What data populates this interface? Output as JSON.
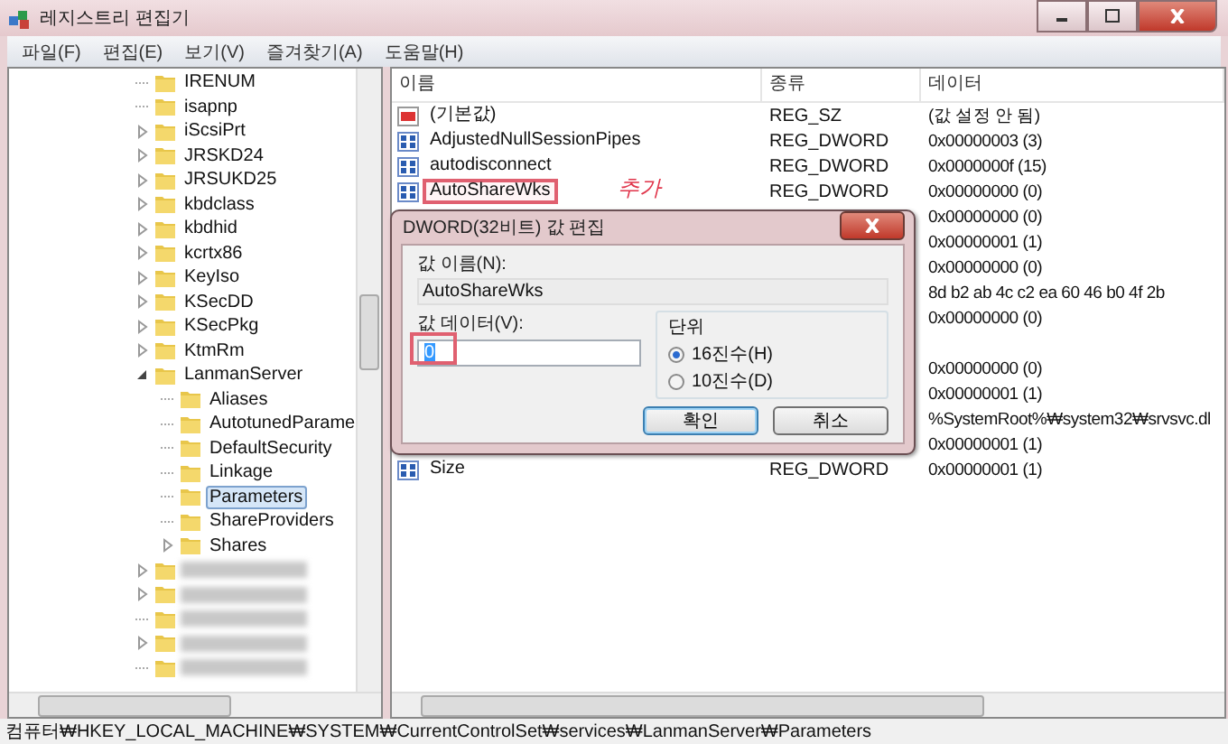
{
  "window": {
    "title": "레지스트리 편집기"
  },
  "menu": [
    "파일(F)",
    "편집(E)",
    "보기(V)",
    "즐겨찾기(A)",
    "도움말(H)"
  ],
  "tree": [
    {
      "label": "IRENUM",
      "has_children": false,
      "selected": false
    },
    {
      "label": "isapnp",
      "has_children": false,
      "selected": false
    },
    {
      "label": "iScsiPrt",
      "has_children": true,
      "expanded": false,
      "selected": false
    },
    {
      "label": "JRSKD24",
      "has_children": true,
      "expanded": false,
      "selected": false
    },
    {
      "label": "JRSUKD25",
      "has_children": true,
      "expanded": false,
      "selected": false
    },
    {
      "label": "kbdclass",
      "has_children": true,
      "expanded": false,
      "selected": false
    },
    {
      "label": "kbdhid",
      "has_children": true,
      "expanded": false,
      "selected": false
    },
    {
      "label": "kcrtx86",
      "has_children": true,
      "expanded": false,
      "selected": false
    },
    {
      "label": "KeyIso",
      "has_children": true,
      "expanded": false,
      "selected": false
    },
    {
      "label": "KSecDD",
      "has_children": true,
      "expanded": false,
      "selected": false
    },
    {
      "label": "KSecPkg",
      "has_children": true,
      "expanded": false,
      "selected": false
    },
    {
      "label": "KtmRm",
      "has_children": true,
      "expanded": false,
      "selected": false
    },
    {
      "label": "LanmanServer",
      "has_children": true,
      "expanded": true,
      "selected": false,
      "children": [
        {
          "label": "Aliases",
          "has_children": false,
          "selected": false
        },
        {
          "label": "AutotunedParame",
          "has_children": false,
          "selected": false
        },
        {
          "label": "DefaultSecurity",
          "has_children": false,
          "selected": false
        },
        {
          "label": "Linkage",
          "has_children": false,
          "selected": false
        },
        {
          "label": "Parameters",
          "has_children": false,
          "selected": true
        },
        {
          "label": "ShareProviders",
          "has_children": false,
          "selected": false
        },
        {
          "label": "Shares",
          "has_children": true,
          "expanded": false,
          "selected": false
        }
      ]
    },
    {
      "kind": "blurred",
      "has_children": true,
      "expanded": false
    },
    {
      "kind": "blurred",
      "has_children": true,
      "expanded": false
    },
    {
      "kind": "blurred",
      "has_children": false
    },
    {
      "kind": "blurred",
      "has_children": true,
      "expanded": false
    },
    {
      "kind": "blurred",
      "has_children": false
    }
  ],
  "list": {
    "columns": [
      "이름",
      "종류",
      "데이터"
    ],
    "rows": [
      {
        "kind": "sz",
        "name": "(기본값)",
        "type": "REG_SZ",
        "data": "(값 설정 안 됨)",
        "highlighted": false
      },
      {
        "kind": "dword",
        "name": "AdjustedNullSessionPipes",
        "type": "REG_DWORD",
        "data": "0x00000003 (3)",
        "highlighted": false
      },
      {
        "kind": "dword",
        "name": "autodisconnect",
        "type": "REG_DWORD",
        "data": "0x0000000f (15)",
        "highlighted": false
      },
      {
        "kind": "dword",
        "name": "AutoShareWks",
        "type": "REG_DWORD",
        "data": "0x00000000 (0)",
        "highlighted": true
      },
      {
        "kind": "hidden",
        "data": "0x00000000 (0)"
      },
      {
        "kind": "hidden",
        "data": "0x00000001 (1)"
      },
      {
        "kind": "hidden",
        "data": "0x00000000 (0)"
      },
      {
        "kind": "hidden",
        "data": "8d b2 ab 4c c2 ea 60 46 b0 4f 2b"
      },
      {
        "kind": "hidden",
        "data": "0x00000000 (0)"
      },
      {
        "kind": "hidden"
      },
      {
        "kind": "hidden",
        "data": "0x00000000 (0)"
      },
      {
        "kind": "hidden",
        "data": "0x00000001 (1)"
      },
      {
        "kind": "hidden",
        "data": "%SystemRoot%₩system32₩srvsvc.dl"
      },
      {
        "kind": "hidden",
        "data": "0x00000001 (1)"
      },
      {
        "kind": "dword",
        "name": "Size",
        "type": "REG_DWORD",
        "data": "0x00000001 (1)",
        "highlighted": false
      }
    ]
  },
  "annotation": "추가",
  "dialog": {
    "title": "DWORD(32비트) 값 편집",
    "name_label": "값 이름(N):",
    "name_value": "AutoShareWks",
    "data_label": "값 데이터(V):",
    "data_value": "0",
    "data_highlighted": true,
    "base_label": "단위",
    "bases": [
      {
        "label": "16진수(H)",
        "selected": true
      },
      {
        "label": "10진수(D)",
        "selected": false
      }
    ],
    "buttons": [
      {
        "label": "확인",
        "default": true
      },
      {
        "label": "취소",
        "default": false
      }
    ]
  },
  "status_bar": "컴퓨터₩HKEY_LOCAL_MACHINE₩SYSTEM₩CurrentControlSet₩services₩LanmanServer₩Parameters"
}
